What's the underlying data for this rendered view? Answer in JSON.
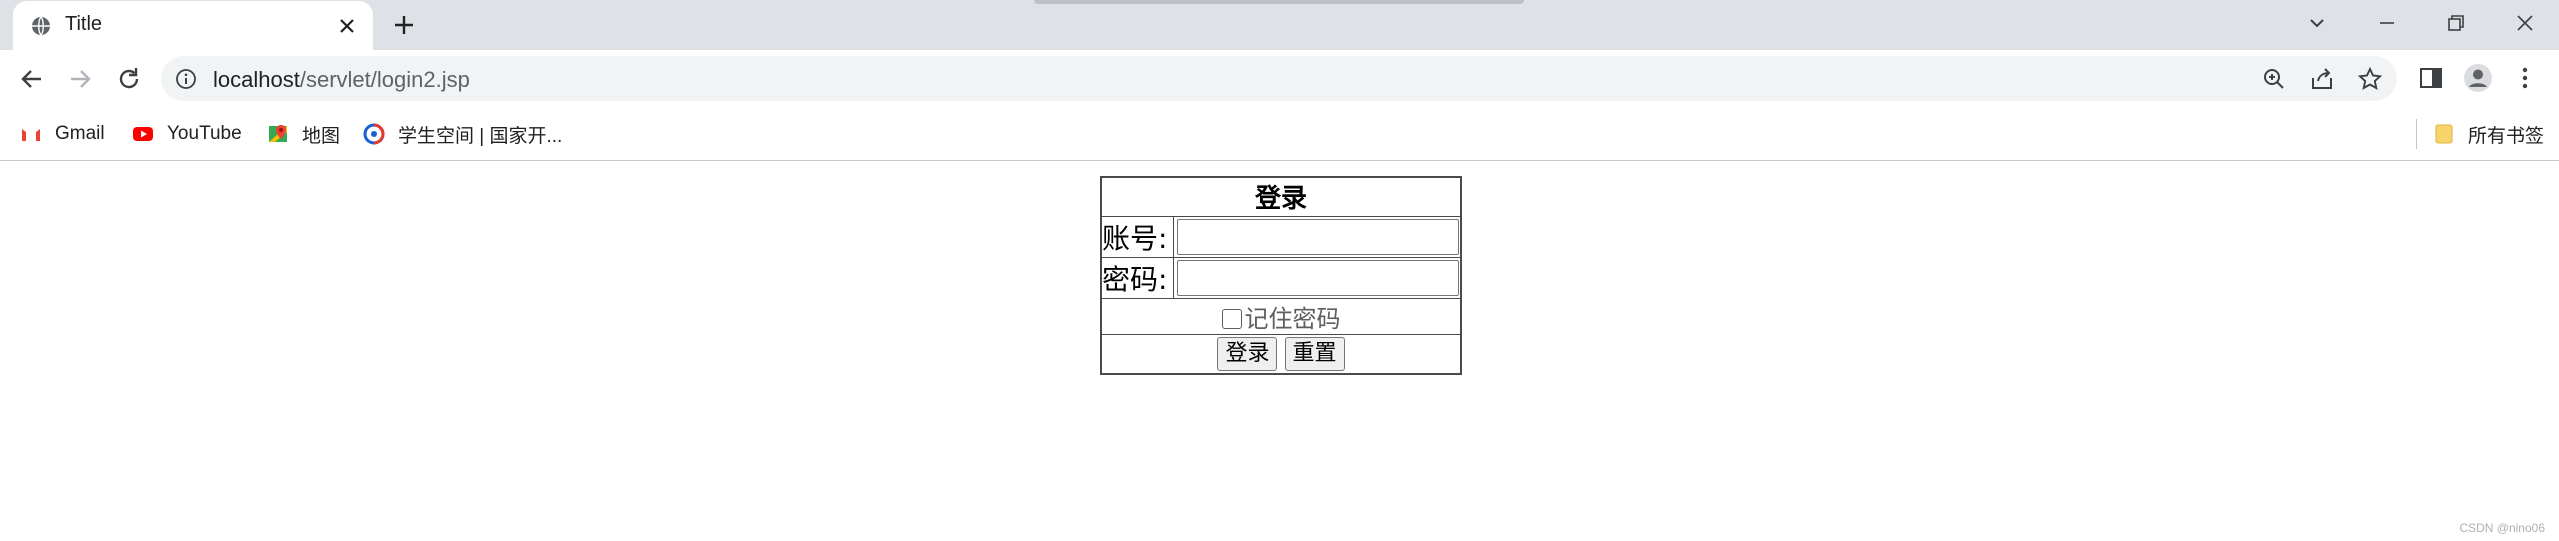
{
  "browser": {
    "tab": {
      "title": "Title",
      "favicon": "globe-icon"
    },
    "url": {
      "host": "localhost",
      "path": "/servlet/login2.jsp"
    },
    "bookmarks": [
      {
        "label": "Gmail",
        "icon": "gmail-icon"
      },
      {
        "label": "YouTube",
        "icon": "youtube-icon"
      },
      {
        "label": "地图",
        "icon": "maps-icon"
      },
      {
        "label": "学生空间 | 国家开...",
        "icon": "edu-icon"
      }
    ],
    "all_bookmarks": "所有书签"
  },
  "login": {
    "title": "登录",
    "account_label": "账号:",
    "password_label": "密码:",
    "account_value": "",
    "password_value": "",
    "remember_label": "记住密码",
    "remember_checked": false,
    "submit_label": "登录",
    "reset_label": "重置"
  },
  "watermark": "CSDN @nino06",
  "colors": {
    "tabbar": "#dee1e6",
    "omnibox": "#f1f3f4",
    "youtube_red": "#ff0000",
    "folder_yellow": "#f7d56c"
  }
}
